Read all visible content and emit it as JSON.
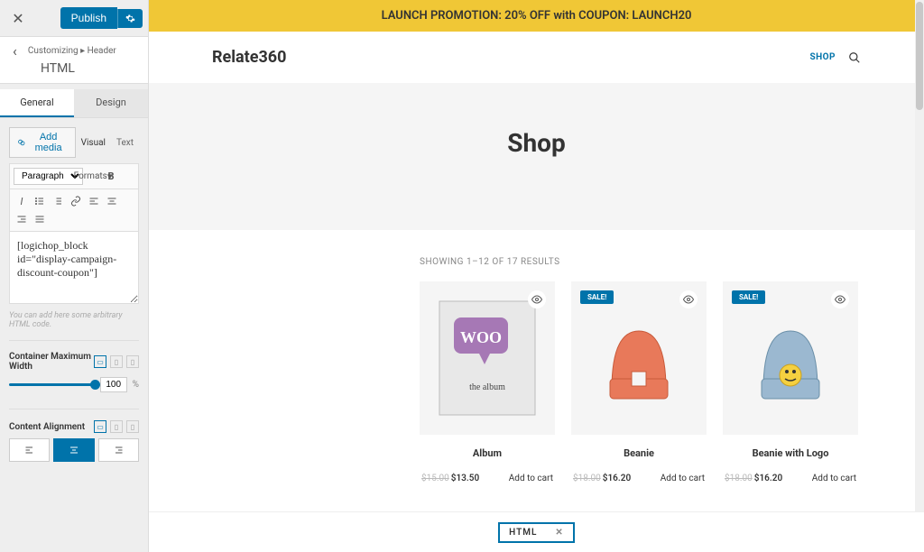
{
  "customizer": {
    "publish": "Publish",
    "breadcrumb": "Customizing ▸ Header",
    "section": "HTML",
    "tabs": {
      "general": "General",
      "design": "Design"
    },
    "add_media": "Add media",
    "visual_tab": "Visual",
    "text_tab": "Text",
    "paragraph_label": "Paragraph",
    "formats_label": "Formats",
    "editor_content": "[logichop_block id=\"display-campaign-discount-coupon\"]",
    "helper": "You can add here some arbitrary HTML code.",
    "max_width_label": "Container Maximum Width",
    "max_width_value": "100",
    "max_width_unit": "%",
    "alignment_label": "Content Alignment"
  },
  "preview": {
    "promo": "LAUNCH PROMOTION: 20% OFF with COUPON: LAUNCH20",
    "site_title": "Relate360",
    "nav_shop": "SHOP",
    "page_title": "Shop",
    "results": "SHOWING 1–12 OF 17 RESULTS",
    "sale_label": "SALE!",
    "products": [
      {
        "title": "Album",
        "old": "$15.00",
        "new": "$13.50",
        "cta": "Add to cart",
        "sale": false
      },
      {
        "title": "Beanie",
        "old": "$18.00",
        "new": "$16.20",
        "cta": "Add to cart",
        "sale": true
      },
      {
        "title": "Beanie with Logo",
        "old": "$18.00",
        "new": "$16.20",
        "cta": "Add to cart",
        "sale": true
      }
    ]
  },
  "bottom": {
    "label": "HTML"
  }
}
